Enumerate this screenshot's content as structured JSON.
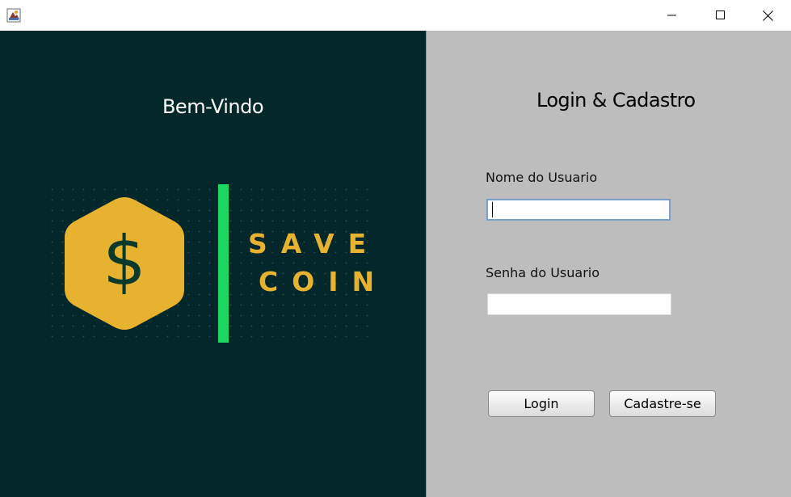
{
  "window": {
    "app_icon": "java-app-icon",
    "controls": [
      "minimize-icon",
      "maximize-icon",
      "close-icon"
    ]
  },
  "left_panel": {
    "welcome_text": "Bem-Vindo",
    "logo": {
      "symbol": "$",
      "line1": "SAVE",
      "line2": "COIN",
      "colors": {
        "background": "#03272a",
        "hexagon": "#e8b231",
        "accent_bar": "#1ed760",
        "text": "#e8b231"
      }
    }
  },
  "right_panel": {
    "title": "Login & Cadastro",
    "username": {
      "label": "Nome do Usuario",
      "value": ""
    },
    "password": {
      "label": "Senha do Usuario",
      "value": ""
    },
    "buttons": {
      "login": "Login",
      "signup": "Cadastre-se"
    },
    "colors": {
      "background": "#bdbdbd"
    }
  }
}
